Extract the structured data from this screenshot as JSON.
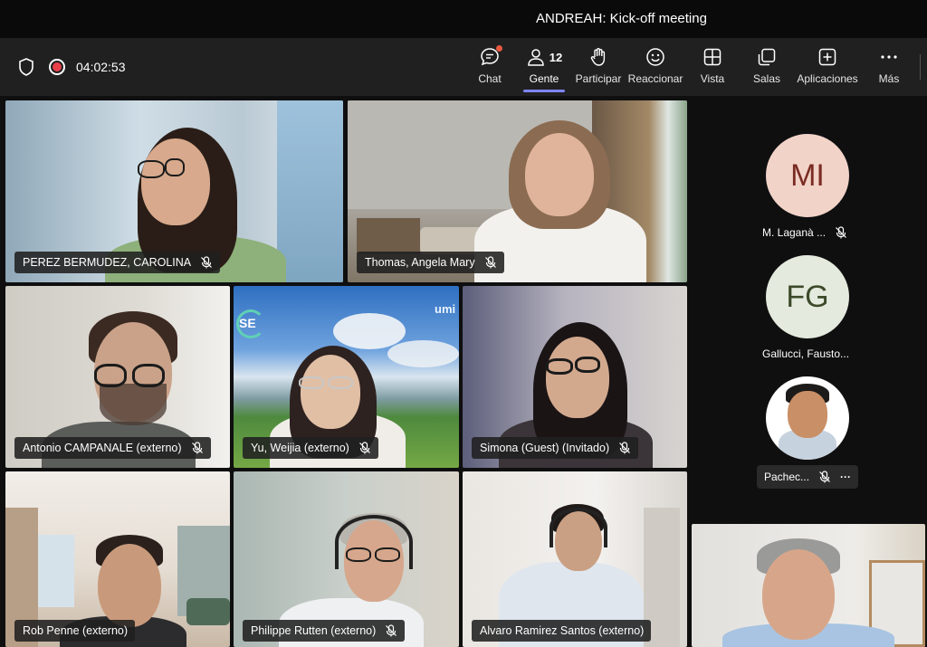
{
  "window": {
    "title": "ANDREAH: Kick-off meeting"
  },
  "meeting": {
    "timer": "04:02:53"
  },
  "toolbar": {
    "chat": "Chat",
    "people": "Gente",
    "people_count": "12",
    "raise_hand": "Participar",
    "react": "Reaccionar",
    "view": "Vista",
    "rooms": "Salas",
    "apps": "Aplicaciones",
    "more": "Más"
  },
  "participants": [
    {
      "name": "PEREZ BERMUDEZ, CAROLINA",
      "muted": true
    },
    {
      "name": "Thomas, Angela Mary",
      "muted": true
    },
    {
      "name": "Antonio CAMPANALE (externo)",
      "muted": true
    },
    {
      "name": "Yu, Weijia (externo)",
      "muted": true
    },
    {
      "name": "Simona (Guest) (Invitado)",
      "muted": true
    },
    {
      "name": "Rob Penne (externo)",
      "muted": true
    },
    {
      "name": "Philippe Rutten (externo)",
      "muted": true
    },
    {
      "name": "Alvaro Ramirez Santos (externo)",
      "muted": true
    }
  ],
  "sidebar": {
    "p1": {
      "initials": "MI",
      "name": "M. Laganà ...",
      "color": "#f2d3c8",
      "text_color": "#7a2c22"
    },
    "p2": {
      "initials": "FG",
      "name": "Gallucci, Fausto...",
      "color": "#e4eadd",
      "text_color": "#3c4a2a"
    },
    "p3": {
      "name": "Pachec...",
      "more": "···"
    }
  },
  "banner_text": {
    "left": "SE",
    "right": "umi"
  },
  "icons": [
    "shield-icon",
    "record-icon",
    "chat-icon",
    "people-icon",
    "hand-icon",
    "react-icon",
    "view-icon",
    "rooms-icon",
    "apps-icon",
    "more-icon",
    "mic-off-icon"
  ]
}
